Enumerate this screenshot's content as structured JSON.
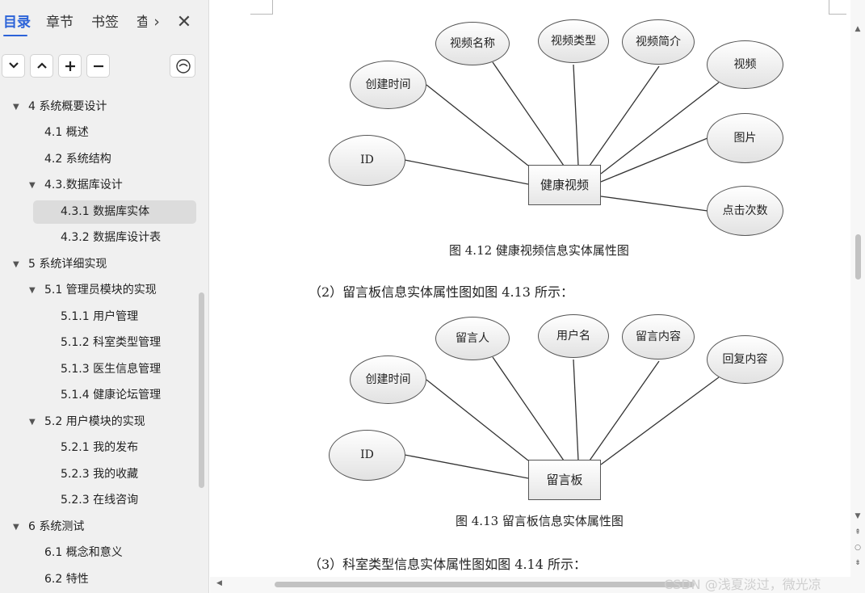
{
  "sidebar": {
    "tabs": [
      "目录",
      "章节",
      "书签",
      "查"
    ],
    "more": "›",
    "close": "✕",
    "tools": {
      "expand": "⌄",
      "collapse": "⌃",
      "add": "+",
      "remove": "−"
    },
    "toc": [
      {
        "label": "4 系统概要设计"
      },
      {
        "label": "4.1 概述"
      },
      {
        "label": "4.2 系统结构"
      },
      {
        "label": "4.3.数据库设计"
      },
      {
        "label": "4.3.1 数据库实体"
      },
      {
        "label": "4.3.2 数据库设计表"
      },
      {
        "label": "5 系统详细实现"
      },
      {
        "label": "5.1  管理员模块的实现"
      },
      {
        "label": "5.1.1  用户管理"
      },
      {
        "label": "5.1.2  科室类型管理"
      },
      {
        "label": "5.1.3  医生信息管理"
      },
      {
        "label": "5.1.4  健康论坛管理"
      },
      {
        "label": "5.2  用户模块的实现"
      },
      {
        "label": "5.2.1  我的发布"
      },
      {
        "label": "5.2.3  我的收藏"
      },
      {
        "label": "5.2.3  在线咨询"
      },
      {
        "label": "6 系统测试"
      },
      {
        "label": "6.1 概念和意义"
      },
      {
        "label": "6.2 特性"
      }
    ]
  },
  "doc": {
    "diagram1": {
      "entity": "健康视频",
      "attributes": [
        "视频名称",
        "视频类型",
        "视频简介",
        "视频",
        "创建时间",
        "图片",
        "ID",
        "点击次数"
      ],
      "caption": "图 4.12   健康视频信息实体属性图"
    },
    "para1": "（2）留言板信息实体属性图如图 4.13 所示：",
    "diagram2": {
      "entity": "留言板",
      "attributes": [
        "留言人",
        "用户名",
        "留言内容",
        "回复内容",
        "创建时间",
        "ID"
      ],
      "caption": "图 4.13   留言板信息实体属性图"
    },
    "para2": "（3）科室类型信息实体属性图如图 4.14 所示：",
    "watermark": "CSDN @浅夏淡过，微光凉"
  },
  "colors": {
    "accent": "#2c63d8",
    "sidebar_bg": "#f0f0f0",
    "selected_bg": "#dcdcdc"
  }
}
